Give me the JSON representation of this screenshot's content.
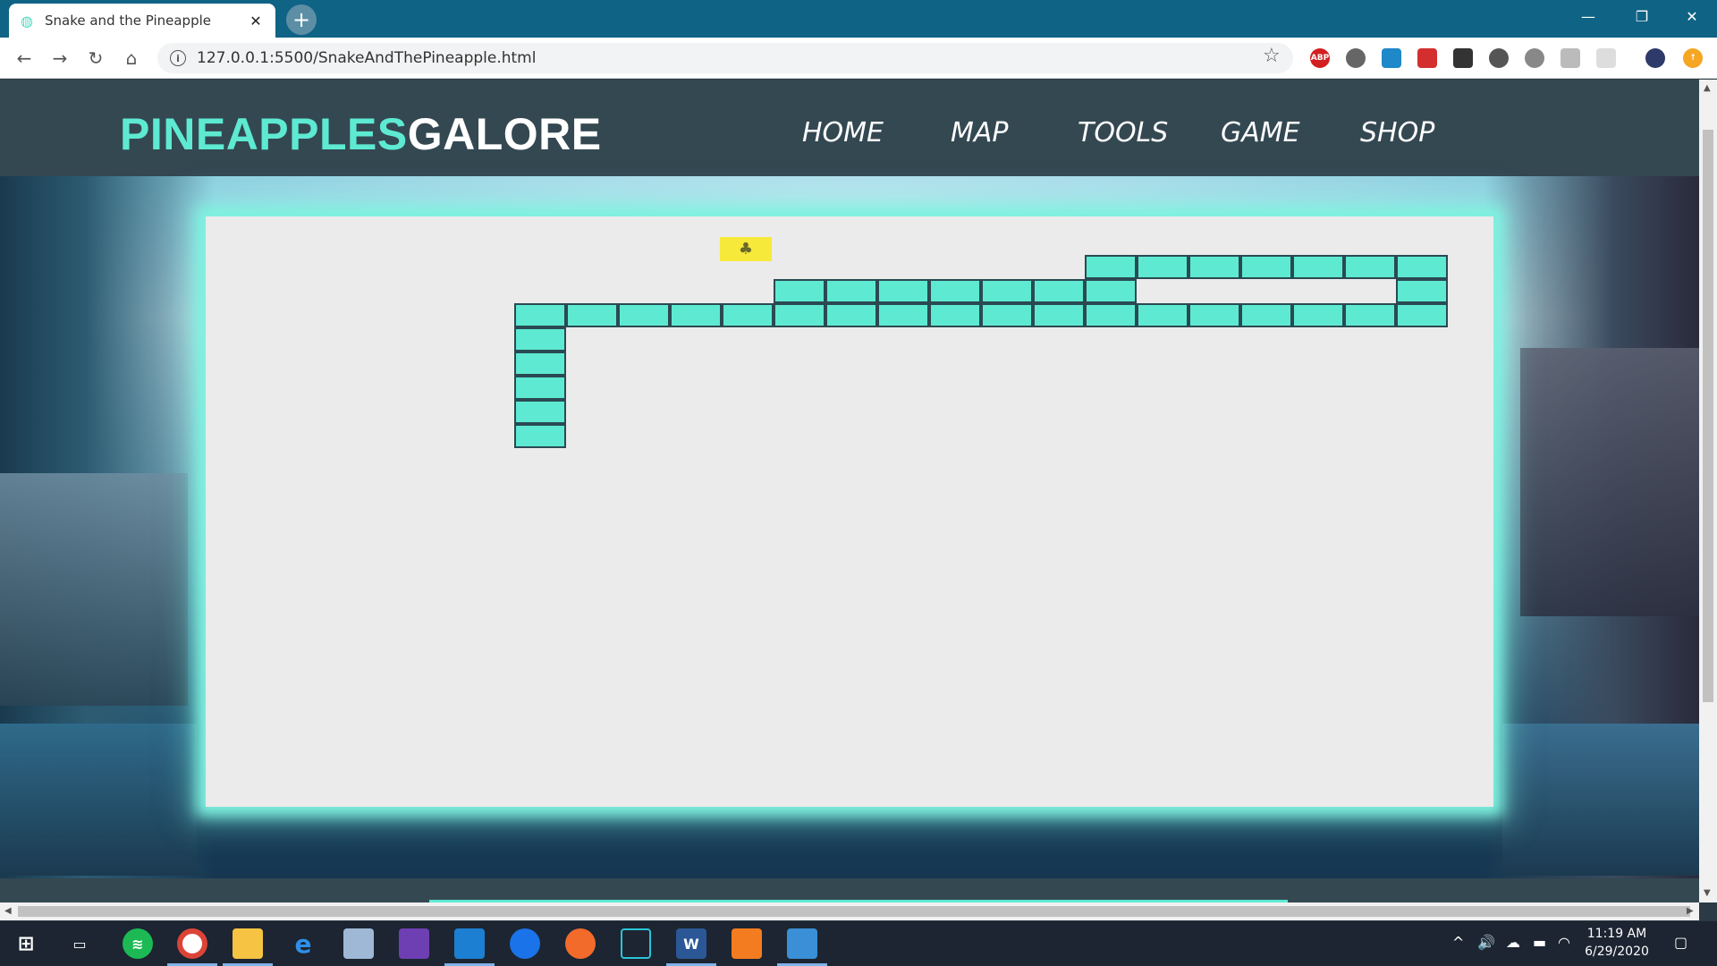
{
  "browser": {
    "tab_title": "Snake and the Pineapple",
    "url": "127.0.0.1:5500/SnakeAndThePineapple.html"
  },
  "site": {
    "logo_part1": "PINEAPPLES",
    "logo_part2": "GALORE",
    "nav": [
      "HOME",
      "MAP",
      "TOOLS",
      "GAME",
      "SHOP"
    ],
    "accent_color": "#5eead2",
    "header_color": "#344852"
  },
  "game": {
    "grid_cell": "58x27",
    "pineapple_color": "#f7e93a",
    "snake_color": "#5eead2"
  },
  "taskbar": {
    "time": "11:19 AM",
    "date": "6/29/2020"
  }
}
